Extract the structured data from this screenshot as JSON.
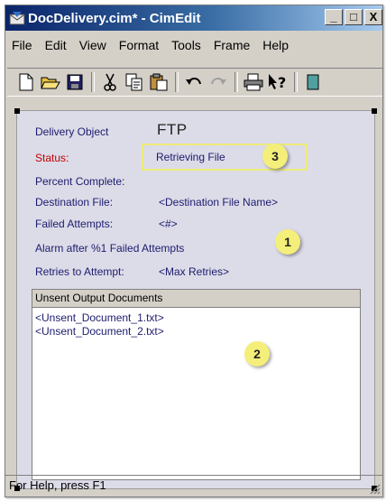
{
  "window": {
    "title": "DocDelivery.cim* - CimEdit",
    "controls": [
      "_",
      "□",
      "X"
    ]
  },
  "menu": [
    "File",
    "Edit",
    "View",
    "Format",
    "Tools",
    "Frame",
    "Help"
  ],
  "toolbar_icons": [
    "new-document-icon",
    "open-folder-icon",
    "save-icon",
    "cut-icon",
    "copy-icon",
    "paste-icon",
    "undo-icon",
    "redo-icon",
    "print-icon",
    "context-help-icon",
    "more-icon"
  ],
  "form": {
    "delivery_object_label": "Delivery Object",
    "delivery_object_value": "FTP",
    "status_label": "Status:",
    "status_value": "Retrieving File",
    "percent_complete_label": "Percent Complete:",
    "destination_file_label": "Destination File:",
    "destination_file_value": "<Destination File Name>",
    "failed_attempts_label": "Failed Attempts:",
    "failed_attempts_value": "<#>",
    "alarm_text": "Alarm after %1 Failed Attempts",
    "retries_label": "Retries to Attempt:",
    "retries_value": "<Max Retries>"
  },
  "unsent": {
    "header": "Unsent Output Documents",
    "items": [
      "<Unsent_Document_1.txt>",
      "<Unsent_Document_2.txt>"
    ]
  },
  "callouts": [
    "1",
    "2",
    "3"
  ],
  "statusbar": {
    "text": "For Help, press F1"
  },
  "colors": {
    "title_bar_start": "#0a246a",
    "label_text": "#1c1c6e",
    "status_label": "#c00000",
    "callout_fill": "#f4ef7a",
    "canvas": "#dcdbe8"
  }
}
